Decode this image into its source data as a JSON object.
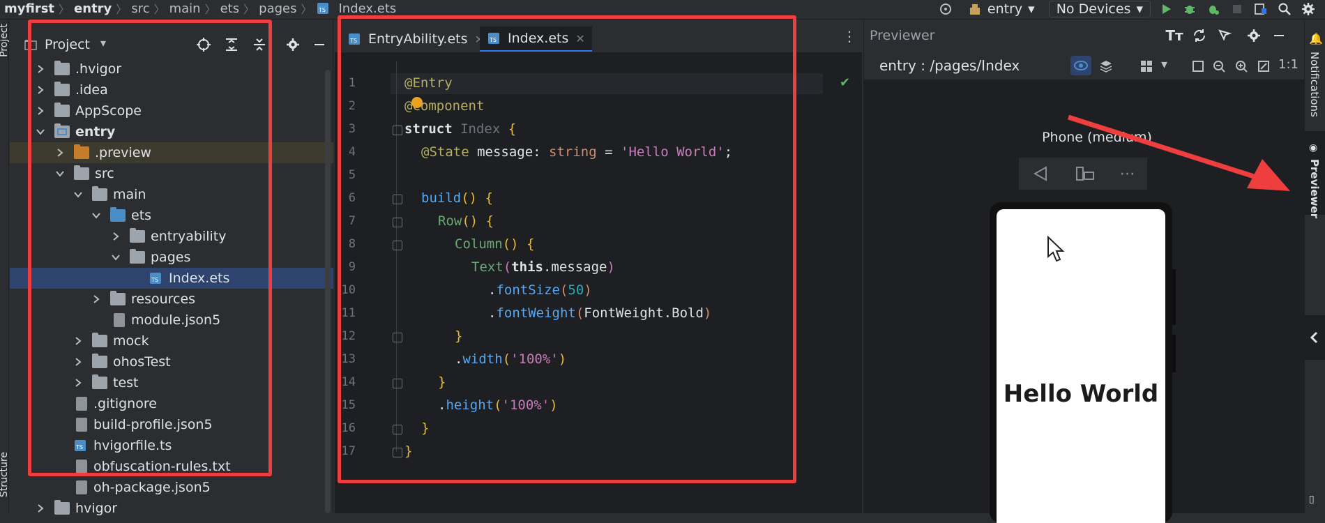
{
  "breadcrumb": [
    "myfirst",
    "entry",
    "src",
    "main",
    "ets",
    "pages",
    "Index.ets"
  ],
  "toolbar": {
    "module_combo": "entry",
    "device_combo": "No Devices"
  },
  "left_stripe": {
    "project_label": "Project",
    "structure_label": "Structure"
  },
  "project_panel": {
    "title": "Project",
    "tree": [
      {
        "label": ".hvigor",
        "icon": "folder-icon",
        "expanded": false
      },
      {
        "label": ".idea",
        "icon": "folder-icon",
        "expanded": false
      },
      {
        "label": "AppScope",
        "icon": "folder-icon",
        "expanded": false
      },
      {
        "label": "entry",
        "icon": "module-folder-icon",
        "expanded": true,
        "bold": true
      },
      {
        "label": ".preview",
        "icon": "folder-orange-icon",
        "expanded": false
      },
      {
        "label": "src",
        "icon": "folder-icon",
        "expanded": true
      },
      {
        "label": "main",
        "icon": "folder-icon",
        "expanded": true
      },
      {
        "label": "ets",
        "icon": "folder-blue-icon",
        "expanded": true
      },
      {
        "label": "entryability",
        "icon": "folder-icon",
        "expanded": false
      },
      {
        "label": "pages",
        "icon": "folder-icon",
        "expanded": true
      },
      {
        "label": "Index.ets",
        "icon": "ets-file-icon",
        "selected": true
      },
      {
        "label": "resources",
        "icon": "folder-icon",
        "expanded": false
      },
      {
        "label": "module.json5",
        "icon": "json-file-icon"
      },
      {
        "label": "mock",
        "icon": "folder-icon",
        "expanded": false
      },
      {
        "label": "ohosTest",
        "icon": "folder-icon",
        "expanded": false
      },
      {
        "label": "test",
        "icon": "folder-icon",
        "expanded": false
      },
      {
        "label": ".gitignore",
        "icon": "gitignore-file-icon"
      },
      {
        "label": "build-profile.json5",
        "icon": "json-file-icon"
      },
      {
        "label": "hvigorfile.ts",
        "icon": "ts-file-icon"
      },
      {
        "label": "obfuscation-rules.txt",
        "icon": "text-file-icon"
      },
      {
        "label": "oh-package.json5",
        "icon": "json-file-icon"
      },
      {
        "label": "hvigor",
        "icon": "folder-icon",
        "expanded": false
      }
    ]
  },
  "editor": {
    "tabs": [
      {
        "label": "EntryAbility.ets",
        "active": false
      },
      {
        "label": "Index.ets",
        "active": true
      }
    ],
    "line_numbers": [
      "1",
      "2",
      "3",
      "4",
      "5",
      "6",
      "7",
      "8",
      "9",
      "10",
      "11",
      "12",
      "13",
      "14",
      "15",
      "16",
      "17"
    ],
    "code": {
      "l1": "@Entry",
      "l2": "@Component",
      "l3_kw": "struct",
      "l3_name": "Index",
      "l3_brace": "{",
      "l4_dec": "@State",
      "l4_var": "message: ",
      "l4_type": "string",
      "l4_eq": " = ",
      "l4_str": "'Hello World'",
      "l4_end": ";",
      "l6_fn": "build",
      "l6_rest": "() {",
      "l7_fn": "Row",
      "l7_rest": "() {",
      "l8_fn": "Column",
      "l8_rest": "() {",
      "l9_fn": "Text",
      "l9_open": "(",
      "l9_this": "this",
      "l9_prop": ".message",
      "l9_close": ")",
      "l10_dot": ".",
      "l10_fn": "fontSize",
      "l10_open": "(",
      "l10_num": "50",
      "l10_close": ")",
      "l11_dot": ".",
      "l11_fn": "fontWeight",
      "l11_open": "(",
      "l11_arg": "FontWeight.Bold",
      "l11_close": ")",
      "l12": "}",
      "l13_dot": ".",
      "l13_fn": "width",
      "l13_open": "(",
      "l13_str": "'100%'",
      "l13_close": ")",
      "l14": "}",
      "l15_dot": ".",
      "l15_fn": "height",
      "l15_open": "(",
      "l15_str": "'100%'",
      "l15_close": ")",
      "l16": "}",
      "l17": "}"
    }
  },
  "previewer": {
    "title": "Previewer",
    "path": "entry : /pages/Index",
    "zoom": "1:1",
    "device_label": "Phone (medium)",
    "screen_text": "Hello World"
  },
  "right_stripe": {
    "notifications_label": "Notifications",
    "previewer_label": "Previewer"
  },
  "colors": {
    "accent": "#3574f0",
    "annotation": "#ef3e3e",
    "selection": "#2e436e"
  }
}
